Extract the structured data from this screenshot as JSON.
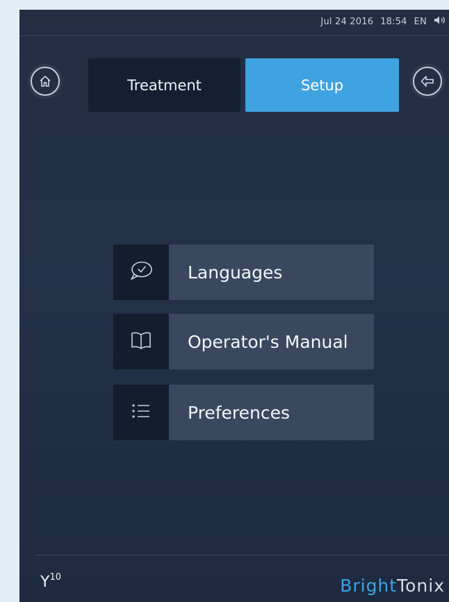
{
  "status_bar": {
    "date": "Jul 24 2016",
    "time": "18:54",
    "language": "EN",
    "volume_icon": "speaker-icon"
  },
  "nav": {
    "home_icon": "home-icon",
    "back_icon": "back-arrow-icon",
    "tabs": [
      {
        "label": "Treatment",
        "active": false
      },
      {
        "label": "Setup",
        "active": true
      }
    ]
  },
  "setup_menu": {
    "items": [
      {
        "label": "Languages",
        "icon": "speech-bubble-check-icon"
      },
      {
        "label": "Operator's Manual",
        "icon": "book-icon"
      },
      {
        "label": "Preferences",
        "icon": "list-icon"
      }
    ]
  },
  "footer": {
    "model_prefix": "Y",
    "model_number": "10",
    "brand_part1": "Bright",
    "brand_part2": "Tonix"
  },
  "colors": {
    "accent": "#3fa3e1",
    "background": "#223149",
    "tab_inactive": "#141f31",
    "menu_label_bg": "#39485f",
    "menu_icon_bg": "#141d2d"
  }
}
